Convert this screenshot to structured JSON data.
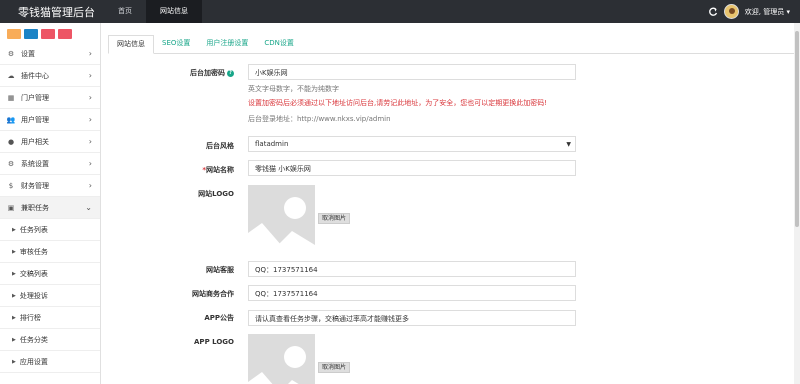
{
  "header": {
    "brand": "零钱猫管理后台",
    "nav": [
      "首页",
      "网站信息"
    ],
    "welcome": "欢迎, 管理员 ▾"
  },
  "sidebar": {
    "quick_buttons": [
      {
        "name": "orange",
        "color": "#f8ac59"
      },
      {
        "name": "blue",
        "color": "#1c84c6"
      },
      {
        "name": "red",
        "color": "#ed5565"
      },
      {
        "name": "red",
        "color": "#ed5565"
      }
    ],
    "items": [
      {
        "label": "设置",
        "icon": "gears-icon"
      },
      {
        "label": "插件中心",
        "icon": "cloud-icon"
      },
      {
        "label": "门户管理",
        "icon": "grid-icon"
      },
      {
        "label": "用户管理",
        "icon": "users-icon"
      },
      {
        "label": "用户相关",
        "icon": "user-icon"
      },
      {
        "label": "系统设置",
        "icon": "cogs-icon"
      },
      {
        "label": "财务管理",
        "icon": "dollar-icon"
      },
      {
        "label": "兼职任务",
        "icon": "briefcase-icon"
      }
    ],
    "subitems": [
      "任务列表",
      "审核任务",
      "交稿列表",
      "处理投诉",
      "排行榜",
      "任务分类",
      "应用设置"
    ]
  },
  "tabs": [
    "网站信息",
    "SEO设置",
    "用户注册设置",
    "CDN设置"
  ],
  "form": {
    "code_label": "后台加密码",
    "code_value": "小K娱乐网",
    "code_help1": "英文字母数字，不能为纯数字",
    "code_help2": "设置加密码后必须通过以下地址访问后台,请劳记此地址，为了安全，您也可以定期更换此加密码!",
    "code_help3": "后台登录地址：http://www.nkxs.vip/admin",
    "style_label": "后台风格",
    "style_value": "flatadmin",
    "name_label": "网站名称",
    "name_value": "零钱猫   小K娱乐网",
    "logo_label": "网站LOGO",
    "cancel_label": "取消图片",
    "service_label": "网站客服",
    "service_value": "QQ：1737571164",
    "biz_label": "网站商务合作",
    "biz_value": "QQ：1737571164",
    "notice_label": "APP公告",
    "notice_value": "请认真查看任务步骤，交稿通过率高才能赚钱更多",
    "applogo_label": "APP LOGO",
    "cancel_label2": "取消图片"
  }
}
